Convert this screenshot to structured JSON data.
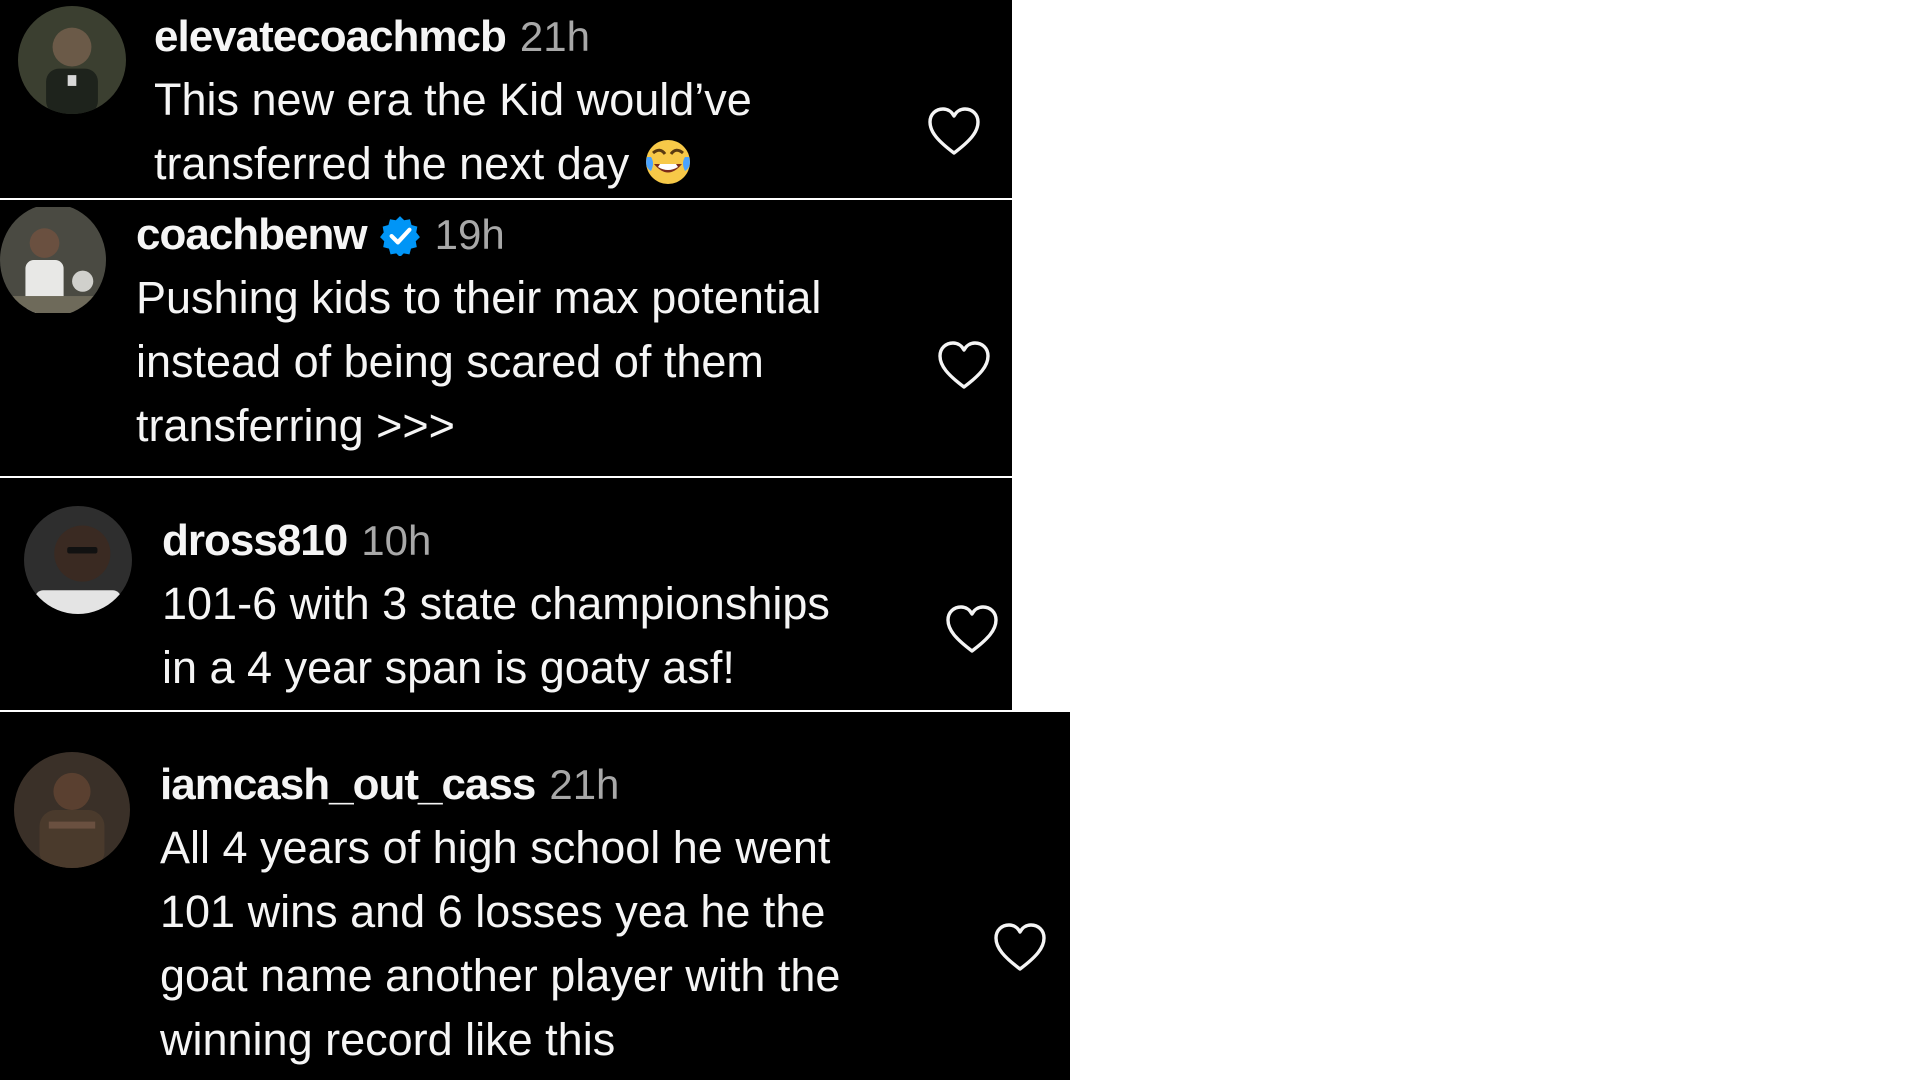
{
  "comments": [
    {
      "username": "elevatecoachmcb",
      "time": "21h",
      "verified": false,
      "lines": [
        "This new era the Kid would’ve",
        "transferred the next day"
      ],
      "emoji": "face-with-tears-of-joy",
      "avatar_color": "#3b3f30"
    },
    {
      "username": "coachbenw",
      "time": "19h",
      "verified": true,
      "lines": [
        "Pushing kids to their max potential",
        "instead of being scared of them",
        "transferring >>>"
      ],
      "avatar_color": "#4a4a42"
    },
    {
      "username": "dross810",
      "time": "10h",
      "verified": false,
      "lines": [
        "101-6 with 3 state championships",
        "in a 4 year span is goaty asf!"
      ],
      "avatar_color": "#2e2e2e"
    },
    {
      "username": "iamcash_out_cass",
      "time": "21h",
      "verified": false,
      "lines": [
        "All 4 years of high school he went",
        "101 wins and 6 losses yea he the",
        "goat name another player with the",
        "winning record like this"
      ],
      "avatar_color": "#3a3028"
    }
  ],
  "colors": {
    "background": "#000000",
    "text": "#f5f5f5",
    "time": "#a8a8a8",
    "verified_badge": "#0095f6",
    "divider": "#ffffff"
  },
  "icons": {
    "like": "heart-outline-icon",
    "verified": "verified-badge-icon"
  }
}
